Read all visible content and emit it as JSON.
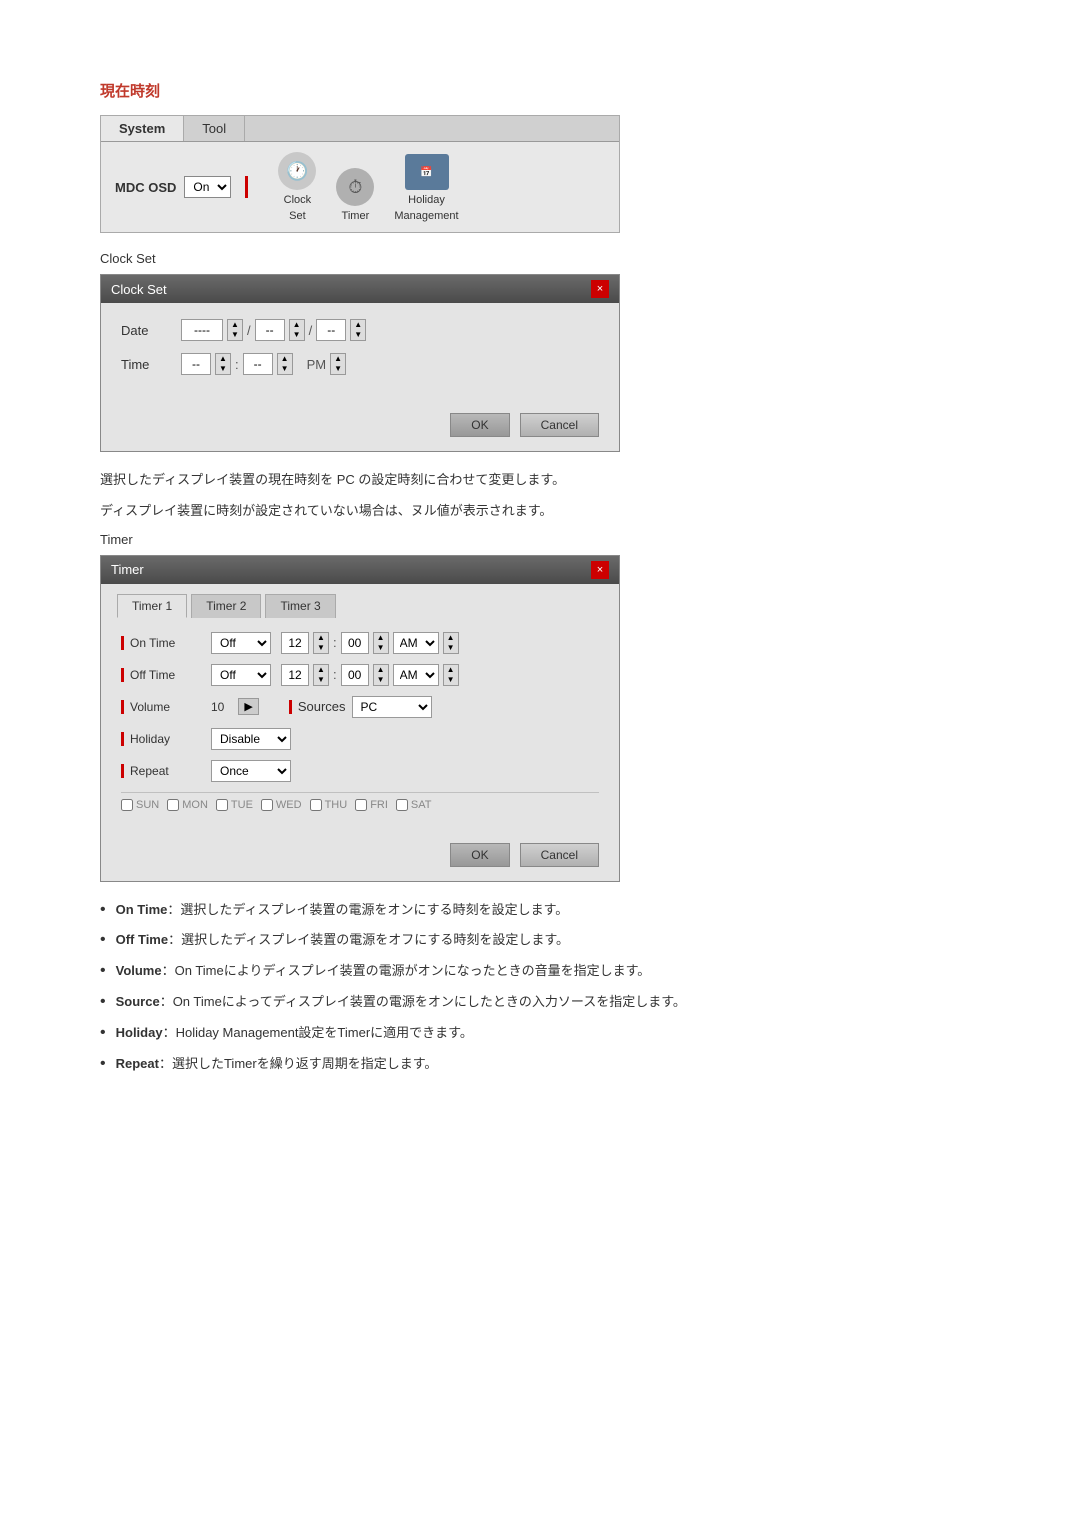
{
  "page": {
    "section_title": "現在時刻",
    "mdc_panel": {
      "tabs": [
        {
          "label": "System",
          "active": true
        },
        {
          "label": "Tool",
          "active": false
        }
      ],
      "osd_label": "MDC OSD",
      "osd_value": "On",
      "icons": [
        {
          "name": "clock-icon",
          "label_line1": "Clock",
          "label_line2": "Set",
          "symbol": "🕐"
        },
        {
          "name": "timer-icon",
          "label": "Timer",
          "symbol": "⏱"
        },
        {
          "name": "holiday-icon",
          "label_line1": "Holiday",
          "label_line2": "Management",
          "symbol": "📅"
        }
      ]
    },
    "clock_set_section": {
      "label": "Clock Set",
      "dialog": {
        "title": "Clock Set",
        "close_btn": "×",
        "date_label": "Date",
        "date_val1": "----",
        "date_sep1": "/",
        "date_val2": "--",
        "date_sep2": "/",
        "date_val3": "--",
        "time_label": "Time",
        "time_val1": "--",
        "time_sep": ":",
        "time_val2": "--",
        "time_ampm": "PM",
        "ok_btn": "OK",
        "cancel_btn": "Cancel"
      }
    },
    "desc1": "選択したディスプレイ装置の現在時刻を PC の設定時刻に合わせて変更します。",
    "desc2": "ディスプレイ装置に時刻が設定されていない場合は、ヌル値が表示されます。",
    "timer_section": {
      "label": "Timer",
      "dialog": {
        "title": "Timer",
        "close_btn": "×",
        "tabs": [
          "Timer 1",
          "Timer 2",
          "Timer 3"
        ],
        "on_time_label": "On Time",
        "off_time_label": "Off Time",
        "on_time_select": "Off",
        "off_time_select": "Off",
        "on_time_hour": "12",
        "on_time_min": "00",
        "on_time_ampm": "AM",
        "off_time_hour": "12",
        "off_time_min": "00",
        "off_time_ampm": "AM",
        "volume_label": "Volume",
        "volume_val": "10",
        "sources_label": "Sources",
        "sources_val": "PC",
        "holiday_label": "Holiday",
        "holiday_val": "Disable",
        "repeat_label": "Repeat",
        "repeat_val": "Once",
        "days": [
          "SUN",
          "MON",
          "TUE",
          "WED",
          "THU",
          "FRI",
          "SAT"
        ],
        "ok_btn": "OK",
        "cancel_btn": "Cancel"
      }
    },
    "bullets": [
      {
        "label": "On Time",
        "text": "：選択したディスプレイ装置の電源をオンにする時刻を設定します。"
      },
      {
        "label": "Off Time",
        "text": "：選択したディスプレイ装置の電源をオフにする時刻を設定します。"
      },
      {
        "label": "Volume",
        "text": "：On Timeによりディスプレイ装置の電源がオンになったときの音量を指定します。"
      },
      {
        "label": "Source",
        "text": "：On Timeによってディスプレイ装置の電源をオンにしたときの入力ソースを指定します。"
      },
      {
        "label": "Holiday",
        "text": "：Holiday Management設定をTimerに適用できます。"
      },
      {
        "label": "Repeat",
        "text": "：選択したTimerを繰り返す周期を指定します。"
      }
    ]
  }
}
